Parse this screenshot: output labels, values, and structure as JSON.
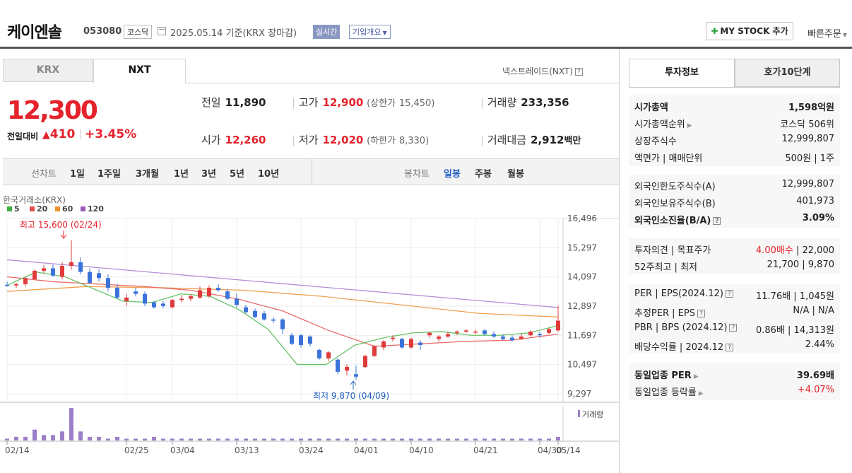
{
  "header": {
    "company": "케이엔솔",
    "code": "053080",
    "market": "코스닥",
    "date": "2025.05.14 기준(KRX 장마감)",
    "realtime": "실시간",
    "corp_overview": "기업개요",
    "my_stock": "MY STOCK 추가",
    "quick_order": "빠른주문"
  },
  "tabs": {
    "krx": "KRX",
    "nxt": "NXT"
  },
  "nxt_label": "넥스트레이드(NXT)",
  "price": {
    "current": "12,300",
    "change_label": "전일대비",
    "change": "410",
    "change_pct": "+3.45%"
  },
  "quote": {
    "prev_label": "전일",
    "prev": "11,890",
    "high_label": "고가",
    "high": "12,900",
    "upper_label": "(상한가",
    "upper": "15,450)",
    "volume_label": "거래량",
    "volume": "233,356",
    "open_label": "시가",
    "open": "12,260",
    "low_label": "저가",
    "low": "12,020",
    "lower_label": "(하한가",
    "lower": "8,330)",
    "amount_label": "거래대금",
    "amount": "2,912",
    "amount_unit": "백만"
  },
  "range": {
    "line_label": "선차트",
    "line_items": [
      "1일",
      "1주일",
      "3개월",
      "1년",
      "3년",
      "5년",
      "10년"
    ],
    "candle_label": "봉차트",
    "candle_items": [
      "일봉",
      "주봉",
      "월봉"
    ]
  },
  "chart_data": {
    "type": "candlestick",
    "source": "한국거래소(KRX)",
    "legend": [
      {
        "name": "5",
        "color": "#3cb13c"
      },
      {
        "name": "20",
        "color": "#e24f4f"
      },
      {
        "name": "60",
        "color": "#f0932b"
      },
      {
        "name": "120",
        "color": "#9b59b6"
      }
    ],
    "yticks": [
      "16,496",
      "15,297",
      "14,097",
      "12,897",
      "11,697",
      "10,497",
      "9,297"
    ],
    "ylim": [
      9297,
      16496
    ],
    "xticks": [
      "02/14",
      "02/25",
      "03/04",
      "03/13",
      "03/24",
      "04/01",
      "04/10",
      "04/21",
      "04/30",
      "05/14"
    ],
    "high_annotation": "최고 15,600 (02/24)",
    "low_annotation": "최저 9,870 (04/09)",
    "volume_label": "거래량",
    "candles": [
      [
        13770,
        13900,
        13700,
        13750
      ],
      [
        13750,
        13850,
        13650,
        13800
      ],
      [
        13800,
        14100,
        13700,
        14050
      ],
      [
        14000,
        14400,
        14000,
        14350
      ],
      [
        14350,
        14600,
        14250,
        14450
      ],
      [
        14450,
        14600,
        14100,
        14150
      ],
      [
        14100,
        14700,
        14000,
        14550
      ],
      [
        14550,
        15600,
        14400,
        14700
      ],
      [
        14700,
        14900,
        14200,
        14300
      ],
      [
        14300,
        14450,
        13800,
        13850
      ],
      [
        14250,
        14400,
        13900,
        14050
      ],
      [
        14050,
        14200,
        13500,
        13650
      ],
      [
        13650,
        13800,
        13200,
        13250
      ],
      [
        13100,
        13400,
        12900,
        13250
      ],
      [
        13500,
        13650,
        13300,
        13400
      ],
      [
        13400,
        13500,
        12900,
        13000
      ],
      [
        13050,
        13100,
        12800,
        12850
      ],
      [
        13000,
        13100,
        12800,
        12900
      ],
      [
        12850,
        13200,
        12800,
        13150
      ],
      [
        13150,
        13350,
        13050,
        13200
      ],
      [
        13200,
        13400,
        13100,
        13300
      ],
      [
        13250,
        13700,
        13200,
        13550
      ],
      [
        13300,
        13750,
        13250,
        13650
      ],
      [
        13650,
        13800,
        13500,
        13550
      ],
      [
        13500,
        13600,
        13150,
        13200
      ],
      [
        13200,
        13400,
        12850,
        12950
      ],
      [
        12850,
        12950,
        12600,
        12650
      ],
      [
        12700,
        12800,
        12400,
        12450
      ],
      [
        12600,
        12700,
        12300,
        12350
      ],
      [
        12350,
        12450,
        12200,
        12300
      ],
      [
        12350,
        12400,
        11750,
        11950
      ],
      [
        11700,
        11800,
        11300,
        11350
      ],
      [
        11700,
        11750,
        11200,
        11300
      ],
      [
        11650,
        11700,
        11250,
        11350
      ],
      [
        11100,
        11150,
        10700,
        10750
      ],
      [
        10750,
        11050,
        10650,
        11000
      ],
      [
        10700,
        10750,
        10100,
        10200
      ],
      [
        10250,
        10500,
        10050,
        10400
      ],
      [
        10100,
        10450,
        9870,
        10000
      ],
      [
        10400,
        10900,
        10350,
        10850
      ],
      [
        10850,
        11300,
        10800,
        11250
      ],
      [
        11200,
        11500,
        11100,
        11450
      ],
      [
        11550,
        11700,
        11450,
        11600
      ],
      [
        11550,
        11600,
        11150,
        11200
      ],
      [
        11200,
        11600,
        11150,
        11550
      ],
      [
        11400,
        11500,
        11100,
        11300
      ],
      [
        11700,
        11850,
        11600,
        11800
      ],
      [
        11550,
        11700,
        11450,
        11650
      ],
      [
        11650,
        11850,
        11600,
        11750
      ],
      [
        11800,
        11900,
        11700,
        11850
      ],
      [
        11850,
        11950,
        11800,
        11900
      ],
      [
        11850,
        11950,
        11750,
        11850
      ],
      [
        11900,
        11950,
        11700,
        11750
      ],
      [
        11750,
        11850,
        11600,
        11650
      ],
      [
        11650,
        11750,
        11500,
        11550
      ],
      [
        11600,
        11700,
        11450,
        11500
      ],
      [
        11550,
        11750,
        11500,
        11650
      ],
      [
        11700,
        11900,
        11650,
        11850
      ],
      [
        11750,
        11850,
        11600,
        11700
      ],
      [
        11800,
        12000,
        11750,
        11950
      ],
      [
        11900,
        12900,
        11850,
        12300
      ]
    ],
    "volumes": [
      1,
      2,
      2,
      6,
      3,
      3,
      5,
      18,
      5,
      2,
      2,
      1,
      2,
      1,
      1,
      1,
      2,
      1,
      1,
      1,
      1,
      1,
      1,
      1,
      1,
      1,
      1,
      1,
      1,
      1,
      1,
      1,
      1,
      1,
      1,
      1,
      1,
      1,
      1,
      1,
      1,
      1,
      1,
      1,
      1,
      1,
      1,
      1,
      1,
      1,
      1,
      1,
      1,
      1,
      1,
      1,
      1,
      1,
      1,
      1,
      2
    ],
    "ma120": [
      14800,
      12840
    ],
    "ma60": [
      13500,
      13700,
      13650,
      13550,
      13300,
      12950,
      12600,
      12450
    ],
    "ma20": [
      14100,
      13900,
      13800,
      13700,
      13550,
      13200,
      12700,
      11900,
      11250,
      11350,
      11450,
      11500,
      11750
    ],
    "ma5": [
      13750,
      14300,
      14100,
      13600,
      13100,
      13050,
      13400,
      13300,
      12750,
      11950,
      10500,
      10500,
      11300,
      11600,
      11800,
      11850,
      11700,
      11700,
      11800,
      12100
    ]
  },
  "right": {
    "tab1": "투자정보",
    "tab2": "호가10단계",
    "group1": [
      {
        "l": "시가총액",
        "r": "1,598억원",
        "bold": true
      },
      {
        "l": "시가총액순위",
        "r": "코스닥 506위",
        "arrow": true
      },
      {
        "l": "상장주식수",
        "r": "12,999,807"
      },
      {
        "l": "액면가 | 매매단위",
        "r": "500원 | 1주"
      }
    ],
    "group2": [
      {
        "l": "외국인한도주식수(A)",
        "r": "12,999,807"
      },
      {
        "l": "외국인보유주식수(B)",
        "r": "401,973"
      },
      {
        "l": "외국인소진율(B/A)",
        "r": "3.09%",
        "bold": true,
        "help": true
      }
    ],
    "group3": [
      {
        "l": "투자의견 | 목표주가",
        "r_red": "4.00매수",
        "r": " | 22,000"
      },
      {
        "l": "52주최고 | 최저",
        "r": "21,700 | 9,870"
      }
    ],
    "group4": [
      {
        "l": "PER | EPS(2024.12)",
        "r": "11.76배 | 1,045원",
        "help": true
      },
      {
        "l": "추정PER | EPS",
        "r": "N/A | N/A",
        "help": true
      },
      {
        "l": "PBR | BPS (2024.12)",
        "r": "0.86배 | 14,313원",
        "help": true
      },
      {
        "l": "배당수익률 | 2024.12",
        "r": "2.44%",
        "help": true
      }
    ],
    "group5": [
      {
        "l": "동일업종 PER",
        "r": "39.69배",
        "bold": true,
        "arrow": true
      },
      {
        "l": "동일업종 등락률",
        "r": "+4.07%",
        "red": true,
        "arrow": true
      }
    ]
  }
}
